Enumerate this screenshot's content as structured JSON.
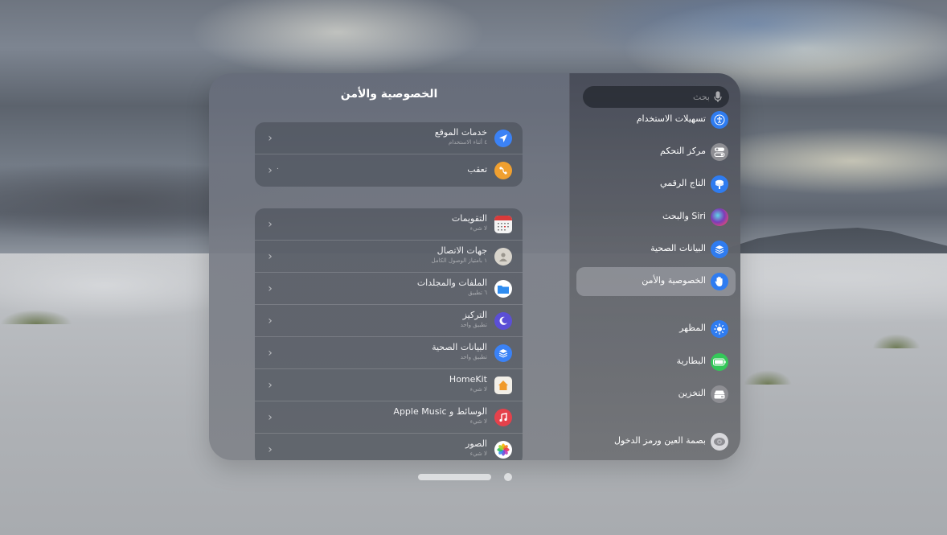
{
  "content": {
    "title": "الخصوصية والأمن",
    "group1": [
      {
        "title": "خدمات الموقع",
        "subtitle": "٤ أثناء الاستخدام",
        "value": "",
        "icon": "location-arrow-icon",
        "color": "#3b82f6"
      },
      {
        "title": "تعقب",
        "subtitle": "",
        "value": "٠",
        "icon": "tracking-icon",
        "color": "#f0a030"
      }
    ],
    "group2": [
      {
        "title": "التقويمات",
        "subtitle": "لا شيء",
        "icon": "calendar-icon",
        "color": "#f4f4f4"
      },
      {
        "title": "جهات الاتصال",
        "subtitle": "١ بامتياز الوصول الكامل",
        "icon": "contacts-icon",
        "color": "#d8d4cc"
      },
      {
        "title": "الملفات والمجلدات",
        "subtitle": "٦ تطبيق",
        "icon": "folder-icon",
        "color": "#ffffff"
      },
      {
        "title": "التركيز",
        "subtitle": "تطبيق واحد",
        "icon": "moon-icon",
        "color": "#5b4fd6"
      },
      {
        "title": "البيانات الصحية",
        "subtitle": "تطبيق واحد",
        "icon": "health-data-icon",
        "color": "#3b82f6"
      },
      {
        "title": "HomeKit",
        "subtitle": "لا شيء",
        "icon": "home-icon",
        "color": "#f2efe8"
      },
      {
        "title": "الوسائط و Apple Music",
        "subtitle": "لا شيء",
        "icon": "music-icon",
        "color": "#e5414b"
      },
      {
        "title": "الصور",
        "subtitle": "لا شيء",
        "icon": "photos-icon",
        "color": "#ffffff"
      }
    ],
    "chevron": "‹"
  },
  "sidebar": {
    "search_placeholder": "بحث",
    "items": [
      {
        "label": "تسهيلات الاستخدام",
        "icon": "accessibility-icon",
        "color": "#2f7cf0",
        "selected": false
      },
      {
        "label": "مركز التحكم",
        "icon": "control-center-icon",
        "color": "#8e8e93",
        "selected": false
      },
      {
        "label": "التاج الرقمي",
        "icon": "digital-crown-icon",
        "color": "#2f7cf0",
        "selected": false
      },
      {
        "label": "Siri والبحث",
        "icon": "siri-icon",
        "color": "#7a3db8",
        "selected": false
      },
      {
        "label": "البيانات الصحية",
        "icon": "health-data-icon",
        "color": "#2f7cf0",
        "selected": false
      },
      {
        "label": "الخصوصية والأمن",
        "icon": "hand-icon",
        "color": "#2f7cf0",
        "selected": true
      },
      {
        "label": "المظهر",
        "icon": "brightness-icon",
        "color": "#2f7cf0",
        "selected": false
      },
      {
        "label": "البطارية",
        "icon": "battery-icon",
        "color": "#34c759",
        "selected": false
      },
      {
        "label": "التخزين",
        "icon": "storage-icon",
        "color": "#8e8e93",
        "selected": false
      },
      {
        "label": "بصمة العين ورمز الدخول",
        "icon": "optic-id-icon",
        "color": "#d8d8dc",
        "selected": false
      }
    ]
  },
  "pager": {
    "pages": 2,
    "current": 1
  }
}
